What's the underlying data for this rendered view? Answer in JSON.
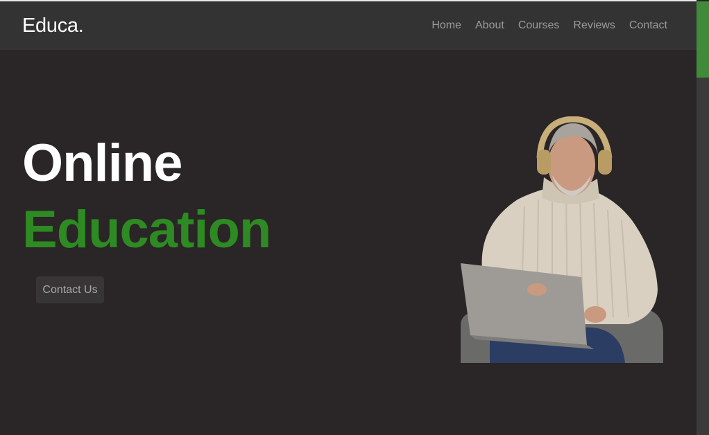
{
  "brand": {
    "logo": "Educa."
  },
  "nav": {
    "items": [
      {
        "label": "Home"
      },
      {
        "label": "About"
      },
      {
        "label": "Courses"
      },
      {
        "label": "Reviews"
      },
      {
        "label": "Contact"
      }
    ]
  },
  "hero": {
    "title_line1": "Online",
    "title_line2": "Education",
    "cta_label": "Contact Us",
    "image_name": "man-with-headphones-laptop-illustration"
  },
  "colors": {
    "background": "#2a2526",
    "navbar": "#333333",
    "accent": "#2e8a22",
    "scrollbar_thumb": "#3f8b3a"
  }
}
